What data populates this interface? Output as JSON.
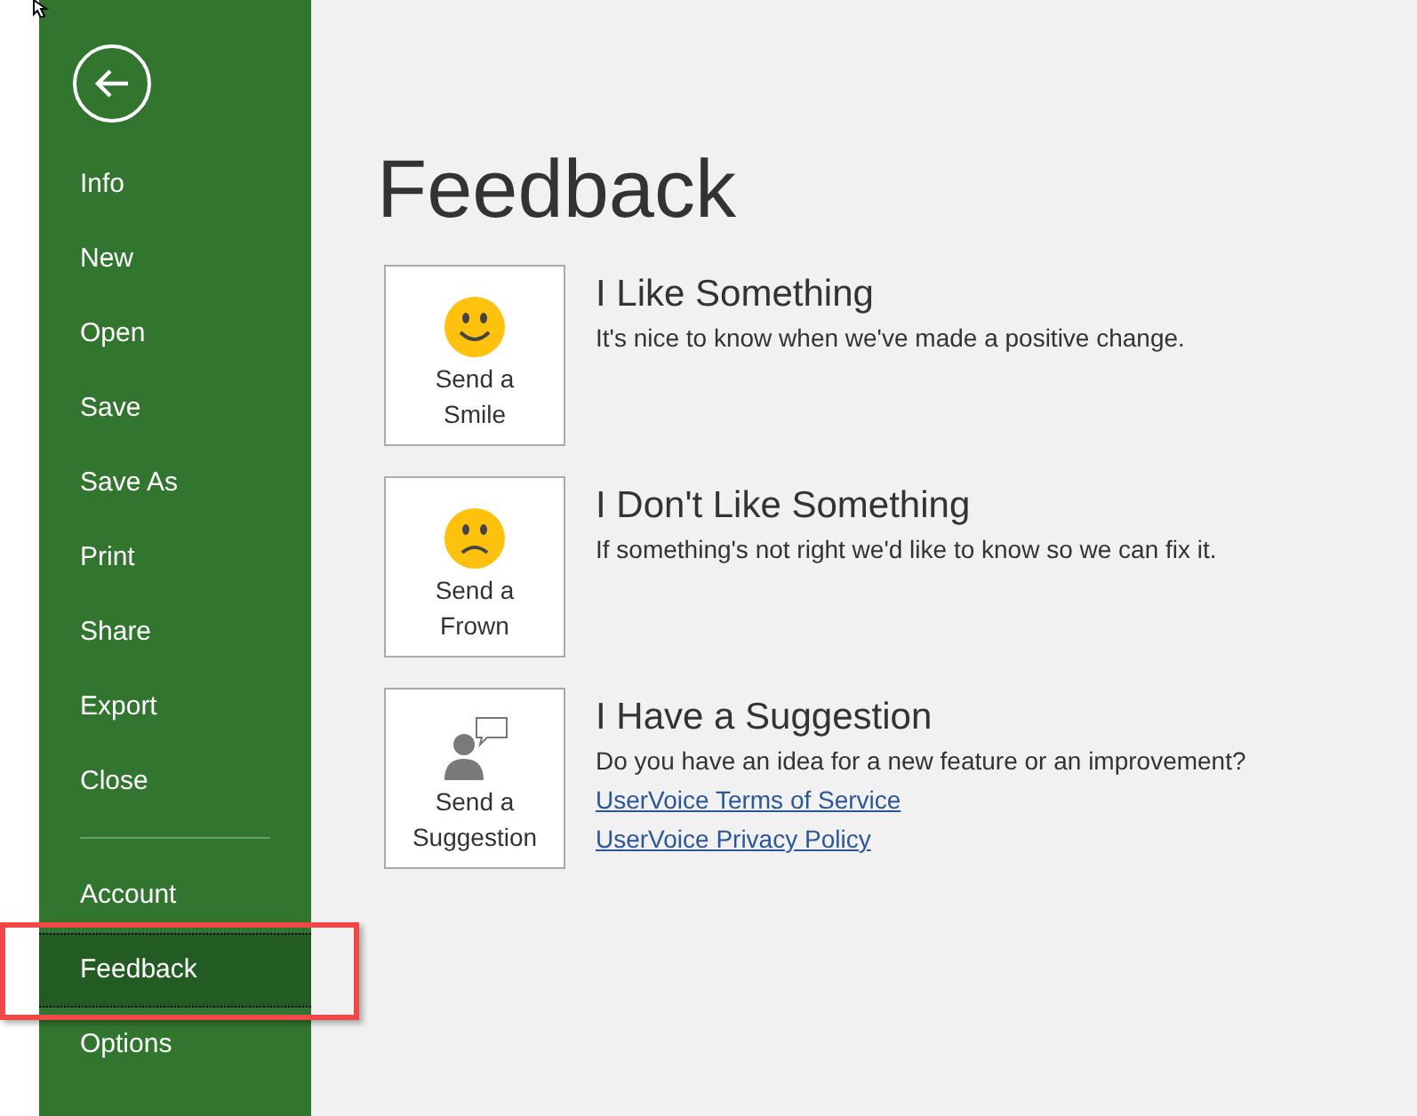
{
  "sidebar": {
    "items": [
      {
        "label": "Info",
        "selected": false
      },
      {
        "label": "New",
        "selected": false
      },
      {
        "label": "Open",
        "selected": false
      },
      {
        "label": "Save",
        "selected": false
      },
      {
        "label": "Save As",
        "selected": false
      },
      {
        "label": "Print",
        "selected": false
      },
      {
        "label": "Share",
        "selected": false
      },
      {
        "label": "Export",
        "selected": false
      },
      {
        "label": "Close",
        "selected": false
      }
    ],
    "bottom_items": [
      {
        "label": "Account",
        "selected": false
      },
      {
        "label": "Feedback",
        "selected": true
      },
      {
        "label": "Options",
        "selected": false
      }
    ]
  },
  "page": {
    "title": "Feedback",
    "options": [
      {
        "kind": "smile",
        "button": [
          "Send a",
          "Smile"
        ],
        "heading": "I Like Something",
        "description": "It's nice to know when we've made a positive change."
      },
      {
        "kind": "frown",
        "button": [
          "Send a",
          "Frown"
        ],
        "heading": "I Don't Like Something",
        "description": "If something's not right we'd like to know so we can fix it."
      },
      {
        "kind": "suggestion",
        "button": [
          "Send a",
          "Suggestion"
        ],
        "heading": "I Have a Suggestion",
        "description": "Do you have an idea for a new feature or an improvement?",
        "links": [
          "UserVoice Terms of Service",
          "UserVoice Privacy Policy"
        ]
      }
    ]
  }
}
